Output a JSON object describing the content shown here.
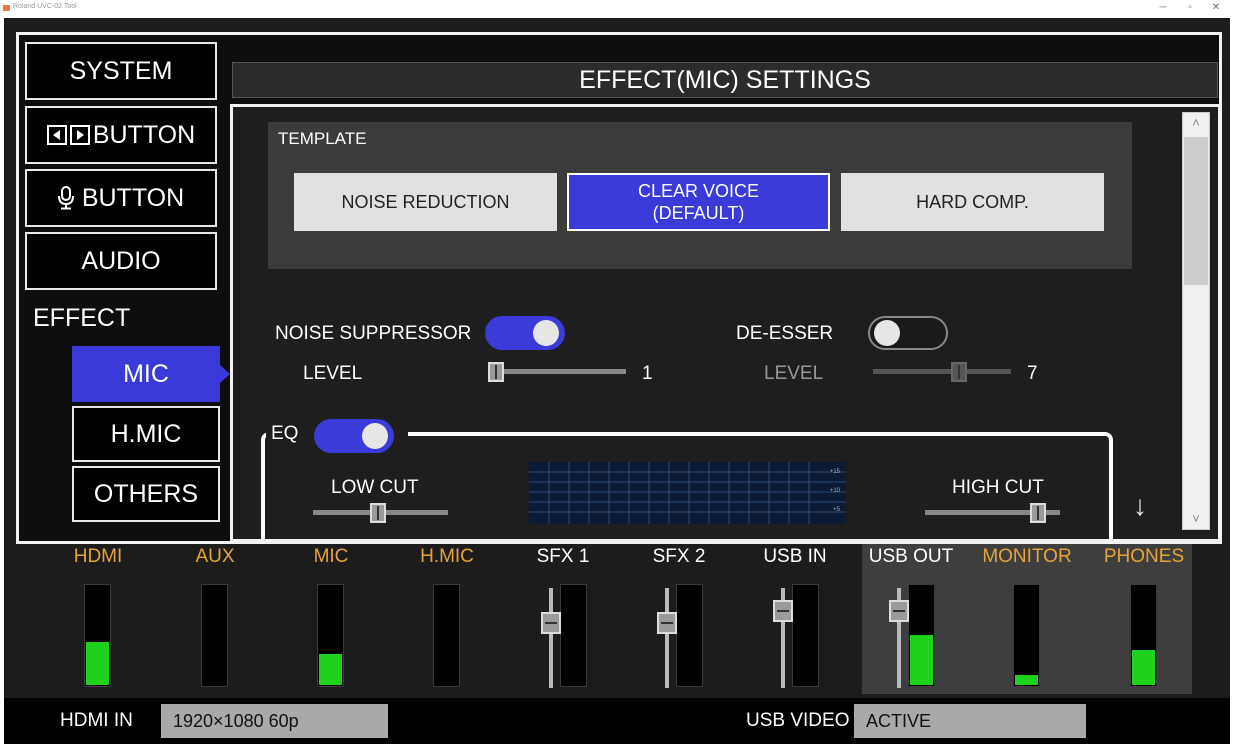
{
  "window": {
    "title": "Roland UVC-02 Tool",
    "minimize": "─",
    "restore": "▫",
    "close": "✕"
  },
  "sidebar": {
    "system": "SYSTEM",
    "arrow_button": "BUTTON",
    "mic_button": "BUTTON",
    "audio": "AUDIO",
    "effect_label": "EFFECT",
    "effect_items": {
      "mic": "MIC",
      "hmic": "H.MIC",
      "others": "OTHERS"
    }
  },
  "header": {
    "title": "EFFECT(MIC) SETTINGS"
  },
  "template": {
    "label": "TEMPLATE",
    "options": {
      "noise_reduction": "NOISE REDUCTION",
      "clear_voice_1": "CLEAR VOICE",
      "clear_voice_2": "(DEFAULT)",
      "hard_comp": "HARD COMP."
    },
    "selected": "CLEAR VOICE (DEFAULT)"
  },
  "noise_suppressor": {
    "label": "NOISE SUPPRESSOR",
    "level_label": "LEVEL",
    "level_value": "1",
    "enabled": true
  },
  "de_esser": {
    "label": "DE-ESSER",
    "level_label": "LEVEL",
    "level_value": "7",
    "enabled": false
  },
  "eq": {
    "label": "EQ",
    "enabled": true,
    "low_cut": "LOW CUT",
    "high_cut": "HIGH CUT",
    "graph_labels": {
      "plus15": "+15",
      "plus10": "+10",
      "plus5": "+5"
    }
  },
  "mixer": {
    "channels": {
      "hdmi": {
        "name": "HDMI",
        "level_pct": 43
      },
      "aux": {
        "name": "AUX",
        "level_pct": 0
      },
      "mic": {
        "name": "MIC",
        "level_pct": 31
      },
      "hmic": {
        "name": "H.MIC",
        "level_pct": 0
      },
      "sfx1": {
        "name": "SFX 1",
        "level_pct": 0
      },
      "sfx2": {
        "name": "SFX 2",
        "level_pct": 0
      },
      "usbin": {
        "name": "USB IN",
        "level_pct": 0
      },
      "usbout": {
        "name": "USB OUT",
        "level_pct": 50
      },
      "monitor": {
        "name": "MONITOR",
        "level_pct": 10
      },
      "phones": {
        "name": "PHONES",
        "level_pct": 35
      }
    }
  },
  "status": {
    "hdmi_in_label": "HDMI IN",
    "hdmi_in_value": "1920×1080 60p",
    "usb_video_label": "USB VIDEO",
    "usb_video_value": "ACTIVE"
  },
  "colors": {
    "accent": "#3a3ad8",
    "meter": "#1dd11d",
    "channel_orange": "#e8a33a"
  }
}
